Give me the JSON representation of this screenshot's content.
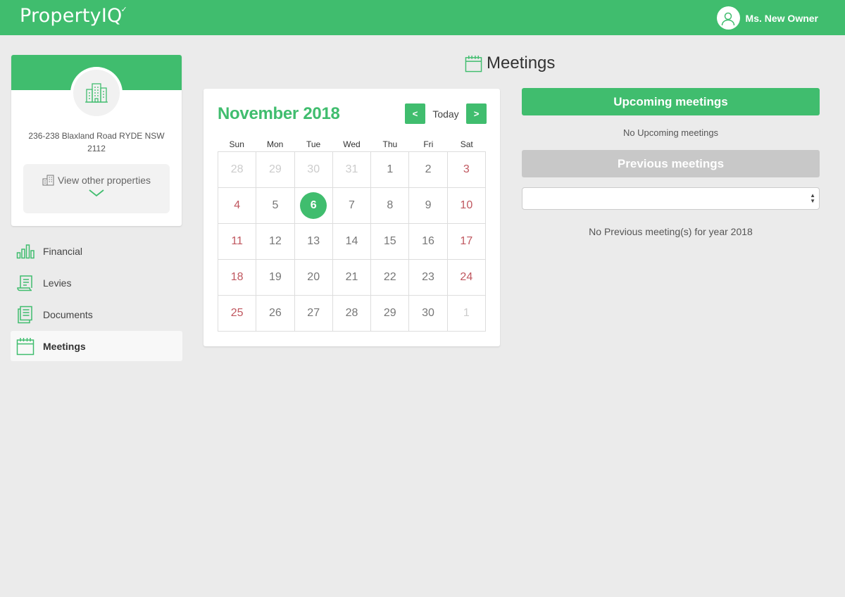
{
  "app": {
    "logo_text": "PropertyIQ",
    "brand_color": "#40bd6e"
  },
  "user": {
    "name": "Ms. New Owner",
    "icon": "user-icon"
  },
  "property": {
    "address": "236-238 Blaxland Road RYDE NSW 2112",
    "icon": "building-icon",
    "view_other_label": "View other properties"
  },
  "nav": {
    "items": [
      {
        "label": "Financial",
        "icon": "bar-chart-icon",
        "active": false
      },
      {
        "label": "Levies",
        "icon": "receipt-icon",
        "active": false
      },
      {
        "label": "Documents",
        "icon": "document-icon",
        "active": false
      },
      {
        "label": "Meetings",
        "icon": "calendar-icon",
        "active": true
      }
    ]
  },
  "page": {
    "title": "Meetings"
  },
  "calendar": {
    "month_label": "November 2018",
    "prev_label": "<",
    "today_label": "Today",
    "next_label": ">",
    "weekdays": [
      "Sun",
      "Mon",
      "Tue",
      "Wed",
      "Thu",
      "Fri",
      "Sat"
    ],
    "weeks": [
      [
        "28",
        "29",
        "30",
        "31",
        "1",
        "2",
        "3"
      ],
      [
        "4",
        "5",
        "6",
        "7",
        "8",
        "9",
        "10"
      ],
      [
        "11",
        "12",
        "13",
        "14",
        "15",
        "16",
        "17"
      ],
      [
        "18",
        "19",
        "20",
        "21",
        "22",
        "23",
        "24"
      ],
      [
        "25",
        "26",
        "27",
        "28",
        "29",
        "30",
        "1"
      ]
    ],
    "muted": [
      [
        0,
        0
      ],
      [
        0,
        1
      ],
      [
        0,
        2
      ],
      [
        0,
        3
      ],
      [
        4,
        6
      ]
    ],
    "today": [
      1,
      2
    ]
  },
  "meetings": {
    "upcoming_label": "Upcoming meetings",
    "upcoming_empty": "No Upcoming meetings",
    "previous_label": "Previous meetings",
    "year_select_value": "",
    "previous_empty": "No Previous meeting(s) for year 2018"
  }
}
